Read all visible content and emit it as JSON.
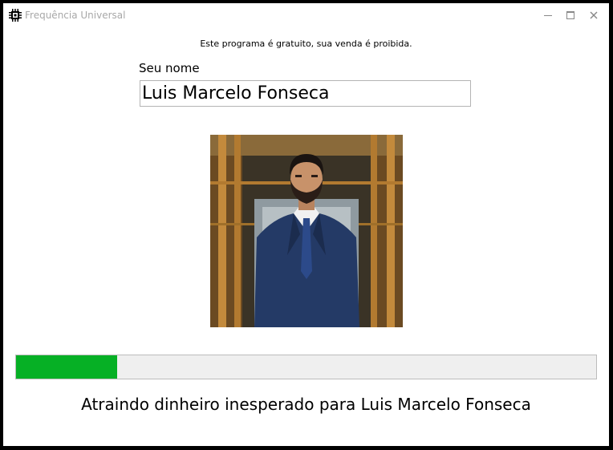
{
  "window": {
    "title": "Frequência Universal",
    "app_icon": "chip-icon",
    "controls": {
      "minimize": "minimize-icon",
      "maximize": "maximize-icon",
      "close": "close-icon"
    }
  },
  "disclaimer": "Este programa é gratuito, sua venda é proibida.",
  "name_field": {
    "label": "Seu nome",
    "value": "Luis Marcelo Fonseca"
  },
  "progress": {
    "fraction": 0.174,
    "fill_color": "#06b025"
  },
  "status_text": "Atraindo dinheiro inesperado para Luis Marcelo Fonseca"
}
